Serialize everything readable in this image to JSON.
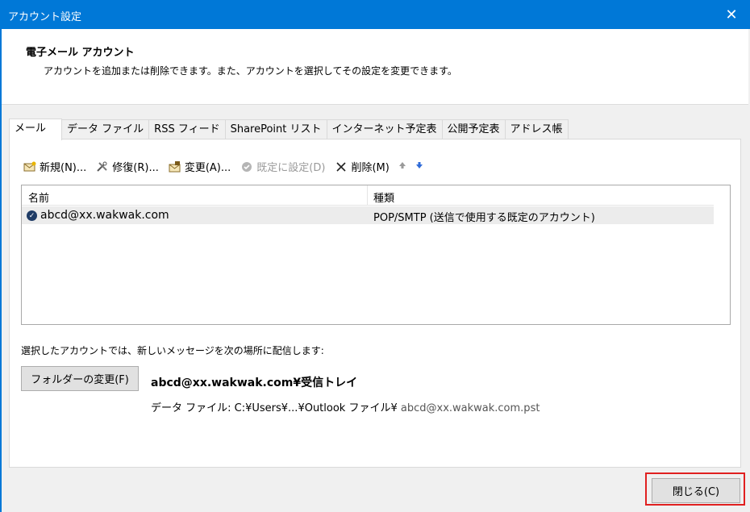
{
  "window": {
    "title": "アカウント設定",
    "close_glyph": "✕"
  },
  "header": {
    "title": "電子メール アカウント",
    "description": "アカウントを追加または削除できます。また、アカウントを選択してその設定を変更できます。"
  },
  "tabs": [
    {
      "label": "メール",
      "active": true
    },
    {
      "label": "データ ファイル"
    },
    {
      "label": "RSS フィード"
    },
    {
      "label": "SharePoint リスト"
    },
    {
      "label": "インターネット予定表"
    },
    {
      "label": "公開予定表"
    },
    {
      "label": "アドレス帳"
    }
  ],
  "toolbar": {
    "new_label": "新規(N)...",
    "repair_label": "修復(R)...",
    "change_label": "変更(A)...",
    "set_default_label": "既定に設定(D)",
    "delete_label": "削除(M)"
  },
  "list": {
    "columns": {
      "name": "名前",
      "type": "種類"
    },
    "rows": [
      {
        "name": "abcd@xx.wakwak.com",
        "type": "POP/SMTP (送信で使用する既定のアカウント)"
      }
    ]
  },
  "delivery": {
    "label": "選択したアカウントでは、新しいメッセージを次の場所に配信します:",
    "change_folder_button": "フォルダーの変更(F)",
    "folder_path": "abcd@xx.wakwak.com¥受信トレイ",
    "data_file_prefix": "データ ファイル: C:¥Users¥...¥Outlook ファイル¥",
    "data_file_name": "abcd@xx.wakwak.com.pst"
  },
  "footer": {
    "close_button": "閉じる(C)"
  },
  "colors": {
    "titlebar": "#0078d7",
    "highlight": "#e02020"
  }
}
